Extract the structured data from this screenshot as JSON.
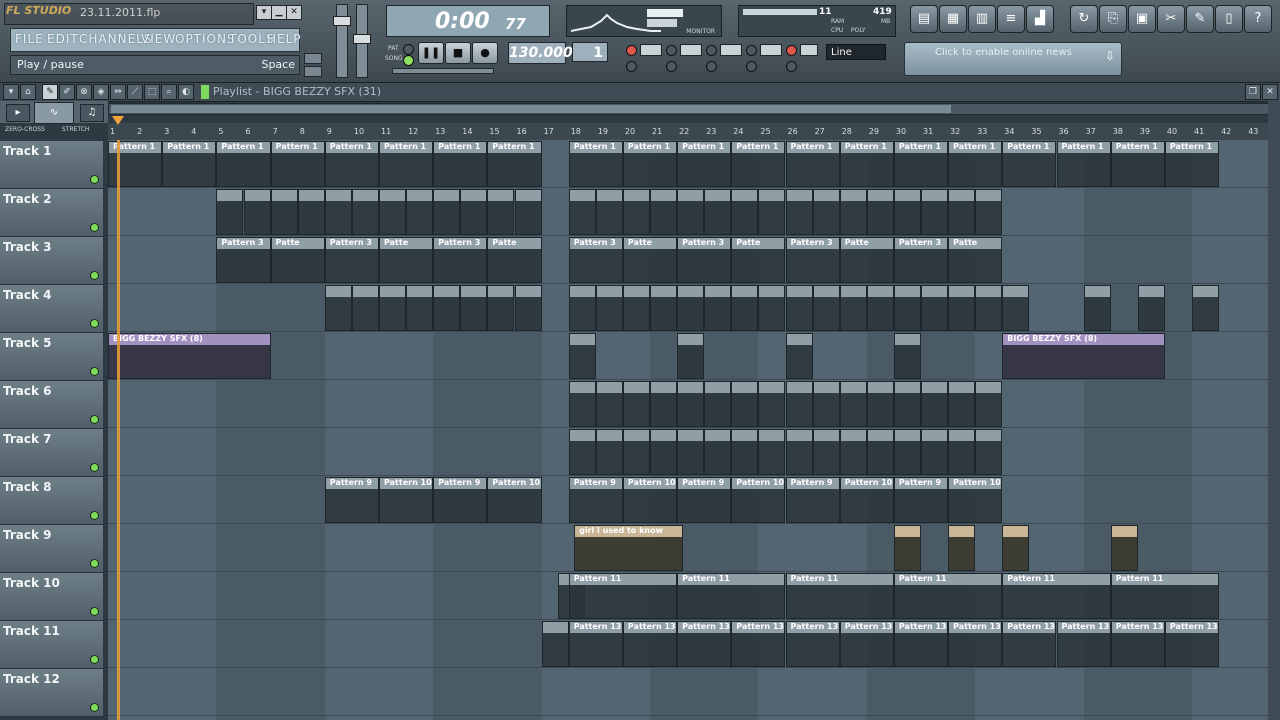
{
  "app": {
    "logo_text": "FL STUDIO",
    "file_name": "23.11.2011.flp"
  },
  "menu": [
    "FILE",
    "EDIT",
    "CHANNELS",
    "VIEW",
    "OPTIONS",
    "TOOLS",
    "HELP"
  ],
  "hint": {
    "text": "Play / pause",
    "shortcut": "Space"
  },
  "time": {
    "main": "0:00",
    "fraction": "77"
  },
  "monitor": {
    "label": "MONITOR"
  },
  "cpu": {
    "ram_label": "RAM",
    "ram_unit": "MB",
    "ram_value": "419",
    "cpu_label": "CPU",
    "poly_label": "POLY",
    "top_value": "11"
  },
  "transport": {
    "pat_label": "PAT",
    "song_label": "SONG",
    "tempo": "130.000",
    "pattern": "1"
  },
  "snap": {
    "selected": "Line"
  },
  "news": {
    "text": "Click to enable online news"
  },
  "playlist": {
    "title": "Playlist - BIGG BEZZY SFX (31)"
  },
  "options": {
    "zero_cross": "ZERO-CROSS",
    "stretch": "STRETCH"
  },
  "ruler": [
    "1",
    "2",
    "3",
    "4",
    "5",
    "6",
    "7",
    "8",
    "9",
    "10",
    "11",
    "12",
    "13",
    "14",
    "15",
    "16",
    "17",
    "18",
    "19",
    "20",
    "21",
    "22",
    "23",
    "24",
    "25",
    "26",
    "27",
    "28",
    "29",
    "30",
    "31",
    "32",
    "33",
    "34",
    "35",
    "36",
    "37",
    "38",
    "39",
    "40",
    "41",
    "42",
    "43"
  ],
  "tracks": [
    "Track 1",
    "Track 2",
    "Track 3",
    "Track 4",
    "Track 5",
    "Track 6",
    "Track 7",
    "Track 8",
    "Track 9",
    "Track 10",
    "Track 11",
    "Track 12"
  ],
  "clip_labels": {
    "pattern1": "Pattern 1",
    "pattern3": "Pattern 3",
    "pattern3_short": "Patte",
    "pattern9": "Pattern 9",
    "pattern10": "Pattern 10",
    "pattern11": "Pattern 11",
    "pattern13": "Pattern 13",
    "bigg": "BIGG BEZZY SFX (8)",
    "girl": "girl i used to know"
  },
  "colors": {
    "accent": "#e59b3b",
    "clip_header": "#909ea6",
    "audio_clip": "#a291c0",
    "led_green": "#7ddc5b"
  }
}
